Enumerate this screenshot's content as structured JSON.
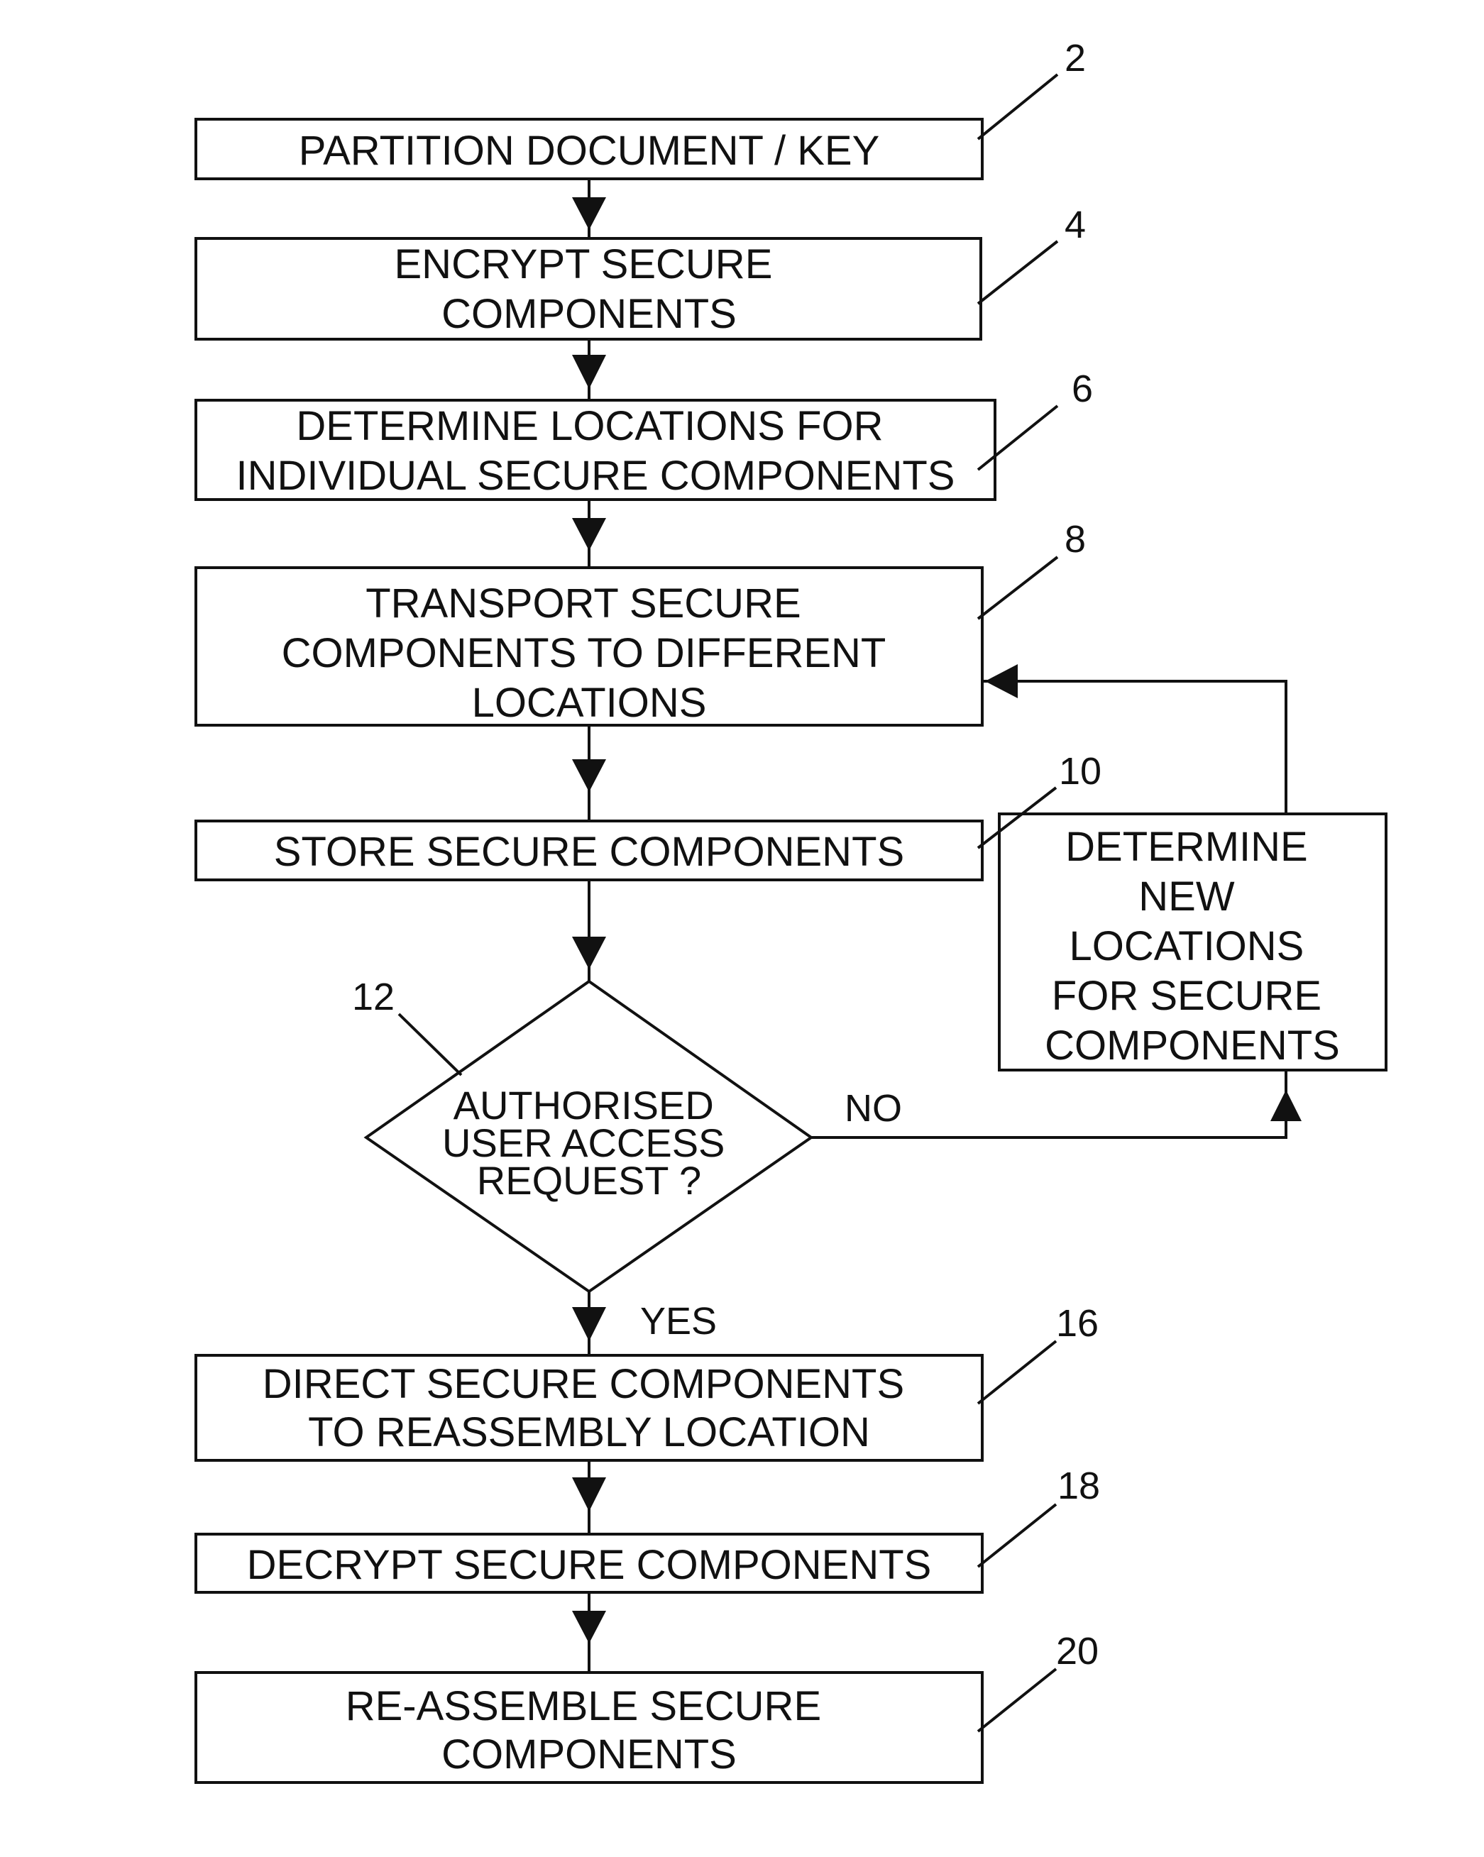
{
  "diagram": {
    "type": "flowchart",
    "steps": [
      {
        "id": "2",
        "ref": "2",
        "lines": [
          "PARTITION DOCUMENT / KEY"
        ]
      },
      {
        "id": "4",
        "ref": "4",
        "lines": [
          "ENCRYPT SECURE",
          "COMPONENTS"
        ]
      },
      {
        "id": "6",
        "ref": "6",
        "lines": [
          "DETERMINE LOCATIONS FOR",
          "INDIVIDUAL SECURE COMPONENTS"
        ]
      },
      {
        "id": "8",
        "ref": "8",
        "lines": [
          "TRANSPORT SECURE",
          "COMPONENTS TO DIFFERENT",
          "LOCATIONS"
        ]
      },
      {
        "id": "10",
        "ref": "10",
        "lines": [
          "STORE SECURE COMPONENTS"
        ]
      },
      {
        "id": "12",
        "ref": "12",
        "lines": [
          "AUTHORISED",
          "USER ACCESS",
          "REQUEST ?"
        ],
        "shape": "decision"
      },
      {
        "id": "16",
        "ref": "16",
        "lines": [
          "DIRECT SECURE COMPONENTS",
          "TO REASSEMBLY LOCATION"
        ]
      },
      {
        "id": "18",
        "ref": "18",
        "lines": [
          "DECRYPT SECURE COMPONENTS"
        ]
      },
      {
        "id": "20",
        "ref": "20",
        "lines": [
          "RE-ASSEMBLE SECURE",
          "COMPONENTS"
        ]
      }
    ],
    "side_step": {
      "id": "new-locations",
      "lines": [
        "DETERMINE",
        "NEW",
        "LOCATIONS",
        "FOR SECURE",
        "COMPONENTS"
      ]
    },
    "branches": {
      "no": "NO",
      "yes": "YES"
    },
    "edges": [
      {
        "from": "2",
        "to": "4"
      },
      {
        "from": "4",
        "to": "6"
      },
      {
        "from": "6",
        "to": "8"
      },
      {
        "from": "8",
        "to": "10"
      },
      {
        "from": "10",
        "to": "12"
      },
      {
        "from": "12",
        "to": "16",
        "label": "YES"
      },
      {
        "from": "12",
        "to": "new-locations",
        "label": "NO"
      },
      {
        "from": "new-locations",
        "to": "8"
      },
      {
        "from": "16",
        "to": "18"
      },
      {
        "from": "18",
        "to": "20"
      }
    ]
  }
}
